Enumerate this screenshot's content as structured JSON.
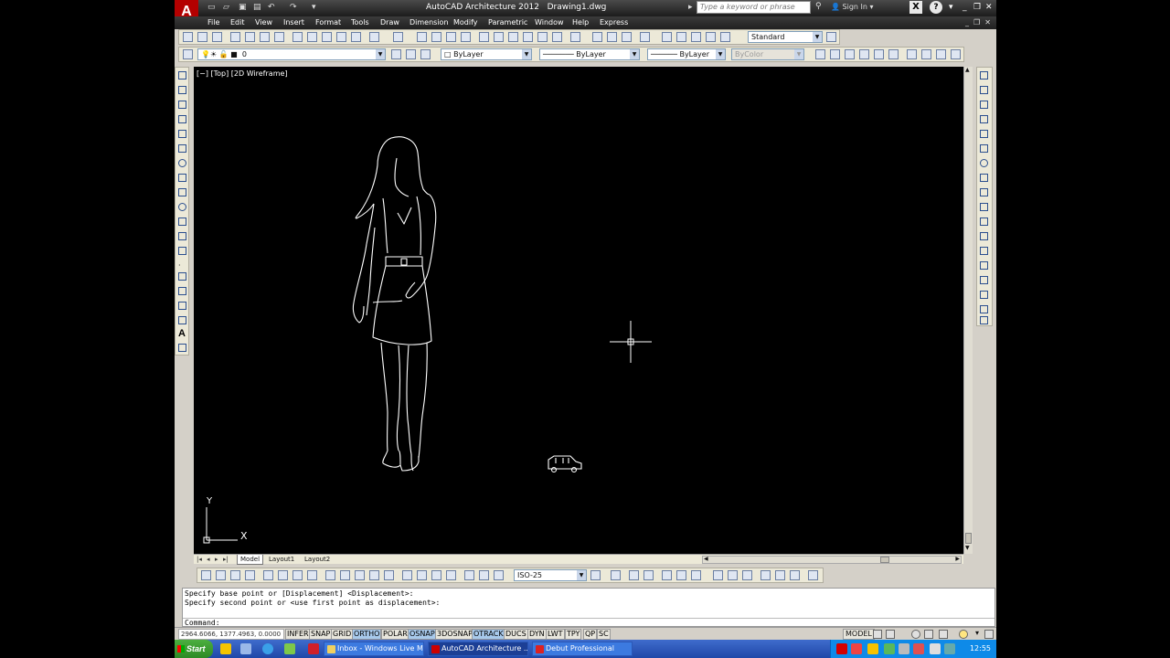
{
  "window": {
    "title": "AutoCAD Architecture 2012",
    "filename": "Drawing1.dwg",
    "search_placeholder": "Type a keyword or phrase",
    "sign_in": "Sign In"
  },
  "menus": [
    "File",
    "Edit",
    "View",
    "Insert",
    "Format",
    "Tools",
    "Draw",
    "Dimension",
    "Modify",
    "Parametric",
    "Window",
    "Help",
    "Express"
  ],
  "toolbars": {
    "text_style": "Standard",
    "layer": "0",
    "color": "ByLayer",
    "linetype": "ByLayer",
    "lineweight": "ByLayer",
    "plot_style": "ByColor",
    "dim_style": "ISO-25"
  },
  "viewport": {
    "label": "[−] [Top] [2D Wireframe]"
  },
  "ucs": {
    "x_label": "X",
    "y_label": "Y"
  },
  "layout_tabs": [
    "Model",
    "Layout1",
    "Layout2"
  ],
  "command_line": {
    "history": [
      "Specify base point or [Displacement] <Displacement>:",
      "Specify second point or <use first point as displacement>:"
    ],
    "prompt": "Command:"
  },
  "status": {
    "coords": "2964.6066, 1377.4963, 0.0000",
    "toggles": [
      {
        "label": "INFER",
        "on": false
      },
      {
        "label": "SNAP",
        "on": false
      },
      {
        "label": "GRID",
        "on": false
      },
      {
        "label": "ORTHO",
        "on": true
      },
      {
        "label": "POLAR",
        "on": false
      },
      {
        "label": "OSNAP",
        "on": true
      },
      {
        "label": "3DOSNAP",
        "on": false
      },
      {
        "label": "OTRACK",
        "on": true
      },
      {
        "label": "DUCS",
        "on": false
      },
      {
        "label": "DYN",
        "on": false
      },
      {
        "label": "LWT",
        "on": false
      },
      {
        "label": "TPY",
        "on": false
      },
      {
        "label": "QP",
        "on": false
      },
      {
        "label": "SC",
        "on": false
      }
    ],
    "model": "MODEL"
  },
  "taskbar": {
    "start": "Start",
    "tasks": [
      {
        "label": "Inbox - Windows Live Mail",
        "active": false
      },
      {
        "label": "AutoCAD Architecture ...",
        "active": true
      },
      {
        "label": "Debut Professional",
        "active": false
      }
    ],
    "clock": "12:55"
  }
}
